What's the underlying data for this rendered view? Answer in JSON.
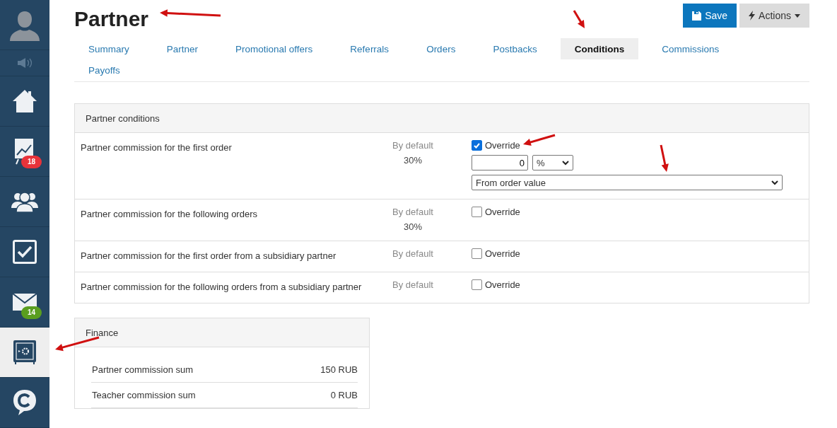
{
  "sidebar": {
    "items": [
      {
        "kind": "avatar",
        "selected": false
      },
      {
        "kind": "speaker",
        "selected": false
      },
      {
        "kind": "home",
        "selected": false
      },
      {
        "kind": "chart",
        "selected": false,
        "badge": "18",
        "color": "#e8333a"
      },
      {
        "kind": "people",
        "selected": false
      },
      {
        "kind": "tasks",
        "selected": false
      },
      {
        "kind": "mail",
        "selected": false,
        "badge": "14",
        "color": "#5a9e1f"
      },
      {
        "kind": "safe",
        "selected": true
      },
      {
        "kind": "logo",
        "selected": false
      }
    ]
  },
  "title": "Partner",
  "buttons": [
    {
      "kind": "save",
      "label": "Save"
    },
    {
      "kind": "actions",
      "label": "Actions"
    }
  ],
  "tabs": [
    {
      "label": "Summary",
      "selected": false
    },
    {
      "label": "Partner",
      "selected": false
    },
    {
      "label": "Promotional offers",
      "selected": false
    },
    {
      "label": "Referrals",
      "selected": false
    },
    {
      "label": "Orders",
      "selected": false
    },
    {
      "label": "Postbacks",
      "selected": false
    },
    {
      "label": "Conditions",
      "selected": true
    },
    {
      "label": "Commissions",
      "selected": false
    },
    {
      "label": "Payoffs",
      "selected": false
    }
  ],
  "conditions": {
    "title": "Partner conditions",
    "rows": [
      {
        "label": "Partner commission for the first order",
        "default_label": "By default",
        "default_value": "30%",
        "override_label": "Override",
        "checked": true,
        "amount": "0",
        "unit": "%",
        "base": "From order value"
      },
      {
        "label": "Partner commission for the following orders",
        "default_label": "By default",
        "default_value": "30%",
        "override_label": "Override",
        "checked": false
      },
      {
        "label": "Partner commission for the first order from a subsidiary partner",
        "default_label": "By default",
        "override_label": "Override",
        "checked": false
      },
      {
        "label": "Partner commission for the following orders from a subsidiary partner",
        "default_label": "By default",
        "override_label": "Override",
        "checked": false
      }
    ]
  },
  "finance": {
    "title": "Finance",
    "rows": [
      {
        "label": "Partner commission sum",
        "value": "150 RUB"
      },
      {
        "label": "Teacher commission sum",
        "value": "0 RUB"
      }
    ]
  }
}
